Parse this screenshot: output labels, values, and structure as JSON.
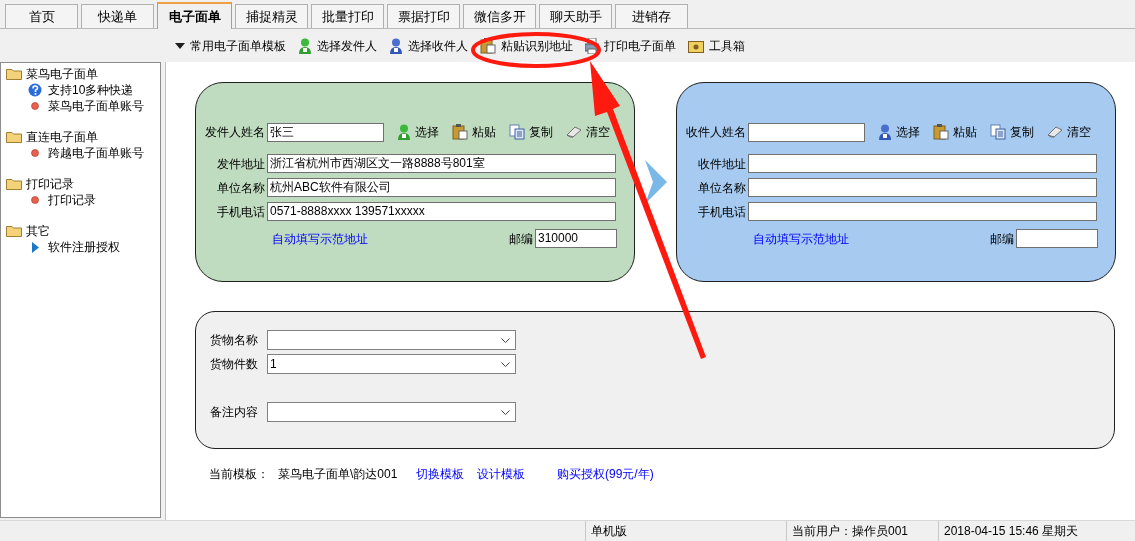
{
  "tabs": [
    {
      "label": "首页",
      "selected": false
    },
    {
      "label": "快递单",
      "selected": false
    },
    {
      "label": "电子面单",
      "selected": true
    },
    {
      "label": "捕捉精灵",
      "selected": false
    },
    {
      "label": "批量打印",
      "selected": false
    },
    {
      "label": "票据打印",
      "selected": false
    },
    {
      "label": "微信多开",
      "selected": false
    },
    {
      "label": "聊天助手",
      "selected": false
    },
    {
      "label": "进销存",
      "selected": false
    }
  ],
  "toolbar": [
    {
      "label": "常用电子面单模板",
      "kind": "dropdown"
    },
    {
      "label": "选择发件人",
      "kind": "sender"
    },
    {
      "label": "选择收件人",
      "kind": "receiver"
    },
    {
      "label": "粘贴识别地址",
      "kind": "paste"
    },
    {
      "label": "打印电子面单",
      "kind": "print"
    },
    {
      "label": "工具箱",
      "kind": "tools"
    }
  ],
  "sidebar": {
    "groups": [
      {
        "label": "菜鸟电子面单",
        "children": [
          {
            "label": "支持10多种快递",
            "kind": "help"
          },
          {
            "label": "菜鸟电子面单账号",
            "kind": "dot"
          }
        ]
      },
      {
        "label": "直连电子面单",
        "children": [
          {
            "label": "跨越电子面单账号",
            "kind": "dot"
          }
        ]
      },
      {
        "label": "打印记录",
        "children": [
          {
            "label": "打印记录",
            "kind": "dot"
          }
        ]
      },
      {
        "label": "其它",
        "children": [
          {
            "label": "软件注册授权",
            "kind": "play"
          }
        ]
      }
    ]
  },
  "sender": {
    "name_label": "发件人姓名",
    "name_value": "张三",
    "actions": [
      {
        "label": "选择",
        "kind": "sender"
      },
      {
        "label": "粘贴",
        "kind": "paste"
      },
      {
        "label": "复制",
        "kind": "copy"
      },
      {
        "label": "清空",
        "kind": "clear"
      }
    ],
    "fields": [
      {
        "label": "发件地址",
        "value": "浙江省杭州市西湖区文一路8888号801室"
      },
      {
        "label": "单位名称",
        "value": "杭州ABC软件有限公司"
      },
      {
        "label": "手机电话",
        "value": "0571-8888xxxx 139571xxxxx"
      }
    ],
    "auto_fill_link": "自动填写示范地址",
    "zip_label": "邮编",
    "zip_value": "310000"
  },
  "receiver": {
    "name_label": "收件人姓名",
    "actions": [
      {
        "label": "选择",
        "kind": "receiver"
      },
      {
        "label": "粘贴",
        "kind": "paste"
      },
      {
        "label": "复制",
        "kind": "copy"
      },
      {
        "label": "清空",
        "kind": "clear"
      }
    ],
    "fields": [
      {
        "label": "收件地址"
      },
      {
        "label": "单位名称"
      },
      {
        "label": "手机电话"
      }
    ],
    "auto_fill_link": "自动填写示范地址",
    "zip_label": "邮编"
  },
  "cargo": {
    "fields": [
      {
        "label": "货物名称",
        "gap": false
      },
      {
        "label": "货物件数",
        "value": "1",
        "gap": false
      },
      {
        "label": "备注内容",
        "gap": true
      }
    ]
  },
  "footer": {
    "template_label": "当前模板：",
    "template_value": "菜鸟电子面单\\韵达001",
    "links": [
      "切换模板",
      "设计模板",
      "购买授权(99元/年)"
    ]
  },
  "status_bar": [
    "单机版",
    "当前用户：操作员001",
    "2018-04-15 15:46 星期天"
  ]
}
